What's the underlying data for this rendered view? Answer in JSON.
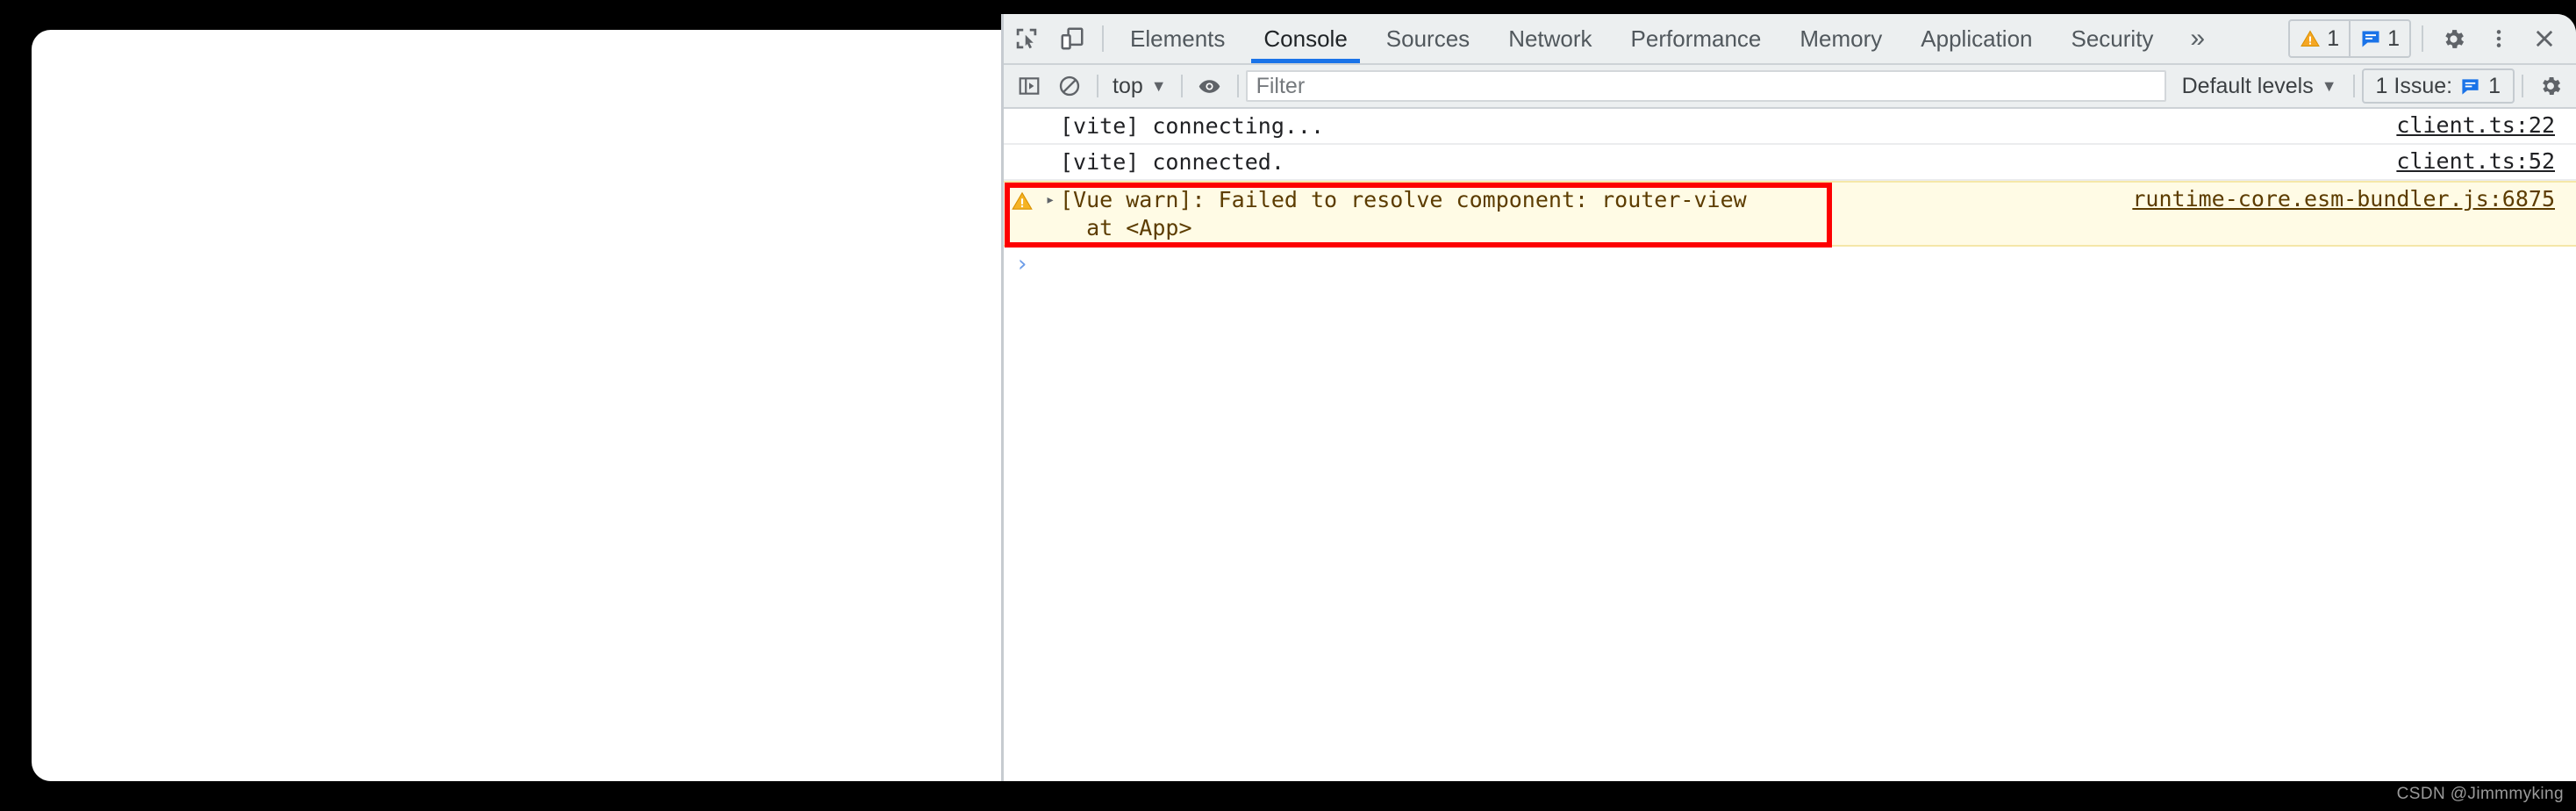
{
  "colors": {
    "accent_blue": "#1a73e8",
    "warning_bg": "#fffbe5",
    "warning_border": "#f5e7a8",
    "annotation_red": "#fd0000",
    "toolbar_bg": "#eceff0",
    "link_underline": "#202124"
  },
  "page_viewport": {
    "name": "blank-app-viewport",
    "background": "#ffffff"
  },
  "devtools": {
    "header": {
      "inspect_icon": "inspect-element-icon",
      "device_toggle_icon": "device-toolbar-icon",
      "tabs": [
        {
          "label": "Elements",
          "active": false
        },
        {
          "label": "Console",
          "active": true
        },
        {
          "label": "Sources",
          "active": false
        },
        {
          "label": "Network",
          "active": false
        },
        {
          "label": "Performance",
          "active": false
        },
        {
          "label": "Memory",
          "active": false
        },
        {
          "label": "Application",
          "active": false
        },
        {
          "label": "Security",
          "active": false
        }
      ],
      "more_tabs_label": "»",
      "counters": [
        {
          "icon": "warning-triangle-icon",
          "count": "1"
        },
        {
          "icon": "issue-message-icon",
          "count": "1"
        }
      ],
      "settings_icon": "gear-icon",
      "more_options_icon": "kebab-menu-icon",
      "close_icon": "close-icon"
    },
    "toolbar": {
      "sidebar_toggle_icon": "console-sidebar-icon",
      "clear_console_icon": "clear-console-icon",
      "context_selector": "top",
      "context_caret": "▼",
      "live_expression_icon": "eye-icon",
      "filter_placeholder": "Filter",
      "filter_value": "",
      "levels_label": "Default levels",
      "levels_caret": "▼",
      "issues_label": "1 Issue:",
      "issues_icon": "issue-message-icon",
      "issues_count": "1",
      "settings_icon": "gear-icon"
    },
    "console": {
      "messages": [
        {
          "level": "info",
          "icon": "",
          "expander": "",
          "text": "[vite] connecting...",
          "source": "client.ts:22"
        },
        {
          "level": "info",
          "icon": "",
          "expander": "",
          "text": "[vite] connected.",
          "source": "client.ts:52"
        },
        {
          "level": "warning",
          "icon": "warning-triangle-icon",
          "expander": "▸",
          "text": "[Vue warn]: Failed to resolve component: router-view\n  at <App>",
          "source": "runtime-core.esm-bundler.js:6875"
        }
      ],
      "prompt_chevron": "›",
      "prompt_value": "",
      "annotation": {
        "name": "red-highlight-box",
        "target": "vue-warn-message"
      }
    }
  },
  "watermark": {
    "text": "CSDN @Jimmmyking"
  }
}
